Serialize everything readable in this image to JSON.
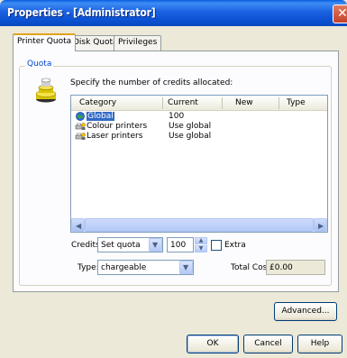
{
  "window": {
    "title": "Properties - [Administrator]",
    "close_glyph": "✕"
  },
  "tabs": [
    {
      "label": "Printer Quota",
      "active": true
    },
    {
      "label": "Disk Quota",
      "active": false
    },
    {
      "label": "Privileges",
      "active": false
    }
  ],
  "quota": {
    "group_label": "Quota",
    "instruction": "Specify the number of credits allocated:",
    "icon": "coin-stack-icon",
    "columns": [
      "Category",
      "Current",
      "New",
      "Type"
    ],
    "rows": [
      {
        "category": "Global",
        "current": "100",
        "icon": "globe-icon",
        "selected": true
      },
      {
        "category": "Colour printers",
        "current": "Use global",
        "icon": "printer-group-icon",
        "selected": false
      },
      {
        "category": "Laser printers",
        "current": "Use global",
        "icon": "printer-group-icon",
        "selected": false
      }
    ],
    "credits_label": "Credits:",
    "credits_mode": "Set quota",
    "credits_value": "100",
    "extra_label": "Extra",
    "extra_checked": false,
    "type_label": "Type:",
    "type_value": "chargeable",
    "total_cost_label": "Total Cost:",
    "total_cost_value": "£0.00"
  },
  "buttons": {
    "advanced": "Advanced...",
    "ok": "OK",
    "cancel": "Cancel",
    "help": "Help"
  },
  "colors": {
    "accent": "#0046d5",
    "selection": "#316ac5",
    "titlebar": "#0a5ee0"
  }
}
